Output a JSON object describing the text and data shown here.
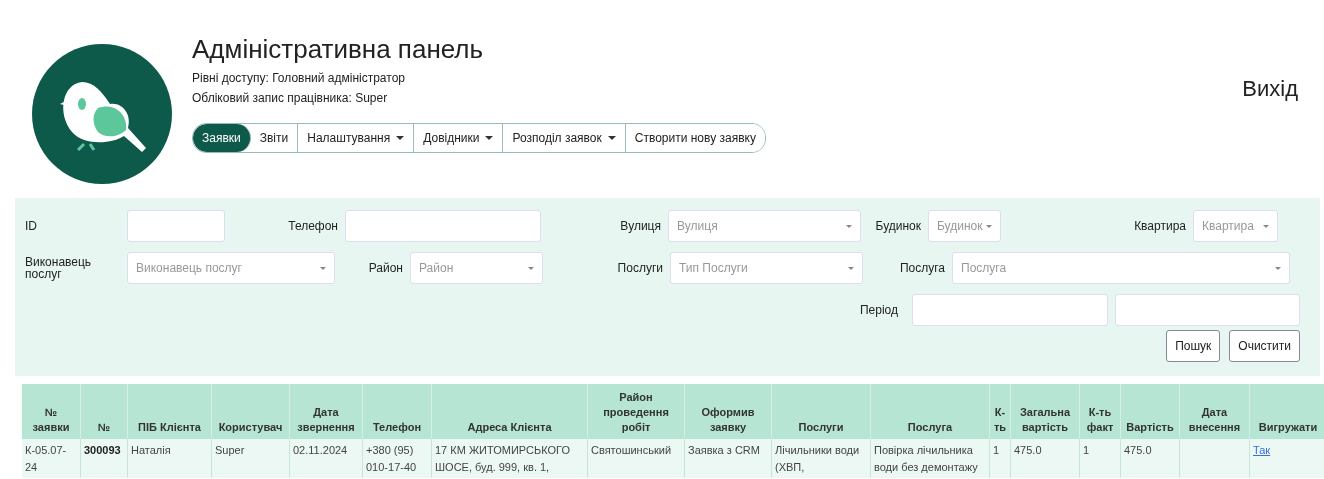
{
  "header": {
    "title": "Адміністративна панель",
    "access_level": "Рівні доступу: Головний адміністратор",
    "account": "Обліковий запис працівника: Super"
  },
  "logout": "Вихід",
  "nav": [
    {
      "label": "Заявки",
      "selected": true,
      "dropdown": false
    },
    {
      "label": "Звіти",
      "selected": false,
      "dropdown": false
    },
    {
      "label": "Налаштування",
      "selected": false,
      "dropdown": true
    },
    {
      "label": "Довідники",
      "selected": false,
      "dropdown": true
    },
    {
      "label": "Розподіл заявок",
      "selected": false,
      "dropdown": true
    },
    {
      "label": "Створити нову заявку",
      "selected": false,
      "dropdown": false
    }
  ],
  "filters": {
    "rows": [
      [
        {
          "label": "ID",
          "kind": "input"
        },
        {
          "label": "Телефон",
          "kind": "input"
        },
        {
          "label": "Вулиця",
          "kind": "select",
          "placeholder": "Вулиця"
        },
        {
          "label": "Будинок",
          "kind": "select",
          "placeholder": "Будинок"
        },
        {
          "label": "Квартира",
          "kind": "select",
          "placeholder": "Квартира"
        }
      ],
      [
        {
          "label": "Виконавець послуг",
          "kind": "select",
          "placeholder": "Виконавець послуг"
        },
        {
          "label": "Район",
          "kind": "select",
          "placeholder": "Район"
        },
        {
          "label": "Послуги",
          "kind": "select",
          "placeholder": "Тип Послуги"
        },
        {
          "label": "Послуга",
          "kind": "select",
          "placeholder": "Послуга"
        }
      ],
      [
        {
          "label": "Період",
          "kind": "input"
        },
        {
          "kind": "input"
        }
      ]
    ],
    "buttons": [
      "Пошук",
      "Очистити"
    ]
  },
  "table": {
    "columns": [
      {
        "title": "№ заявки",
        "kind": "text"
      },
      {
        "title": "№",
        "kind": "bold"
      },
      {
        "title": "ПІБ Клієнта",
        "kind": "text"
      },
      {
        "title": "Користувач",
        "kind": "text"
      },
      {
        "title": "Дата звернення",
        "kind": "text"
      },
      {
        "title": "Телефон",
        "kind": "text"
      },
      {
        "title": "Адреса Клієнта",
        "kind": "text"
      },
      {
        "title": "Район проведення робіт",
        "kind": "text"
      },
      {
        "title": "Оформив заявку",
        "kind": "text"
      },
      {
        "title": "Послуги",
        "kind": "text"
      },
      {
        "title": "Послуга",
        "kind": "text"
      },
      {
        "title": "К-ть",
        "kind": "text"
      },
      {
        "title": "Загальна вартість",
        "kind": "text"
      },
      {
        "title": "К-ть факт",
        "kind": "text"
      },
      {
        "title": "Вартість",
        "kind": "text"
      },
      {
        "title": "Дата внесення",
        "kind": "text"
      },
      {
        "title": "Вигружати",
        "kind": "link"
      }
    ],
    "rows": [
      {
        "cells": [
          "К-05.07-24",
          "300093",
          "Наталія",
          "Super",
          "02.11.2024",
          "+380 (95) 010-17-40",
          "17 КМ ЖИТОМИРСЬКОГО ШОСЕ, буд. 999, кв. 1,",
          "Святошинський",
          "Заявка з CRM",
          "Лічильники води (ХВП,",
          "Повірка лічильника води без демонтажу",
          "1",
          "475.0",
          "1",
          "475.0",
          "",
          "Так"
        ]
      }
    ]
  }
}
